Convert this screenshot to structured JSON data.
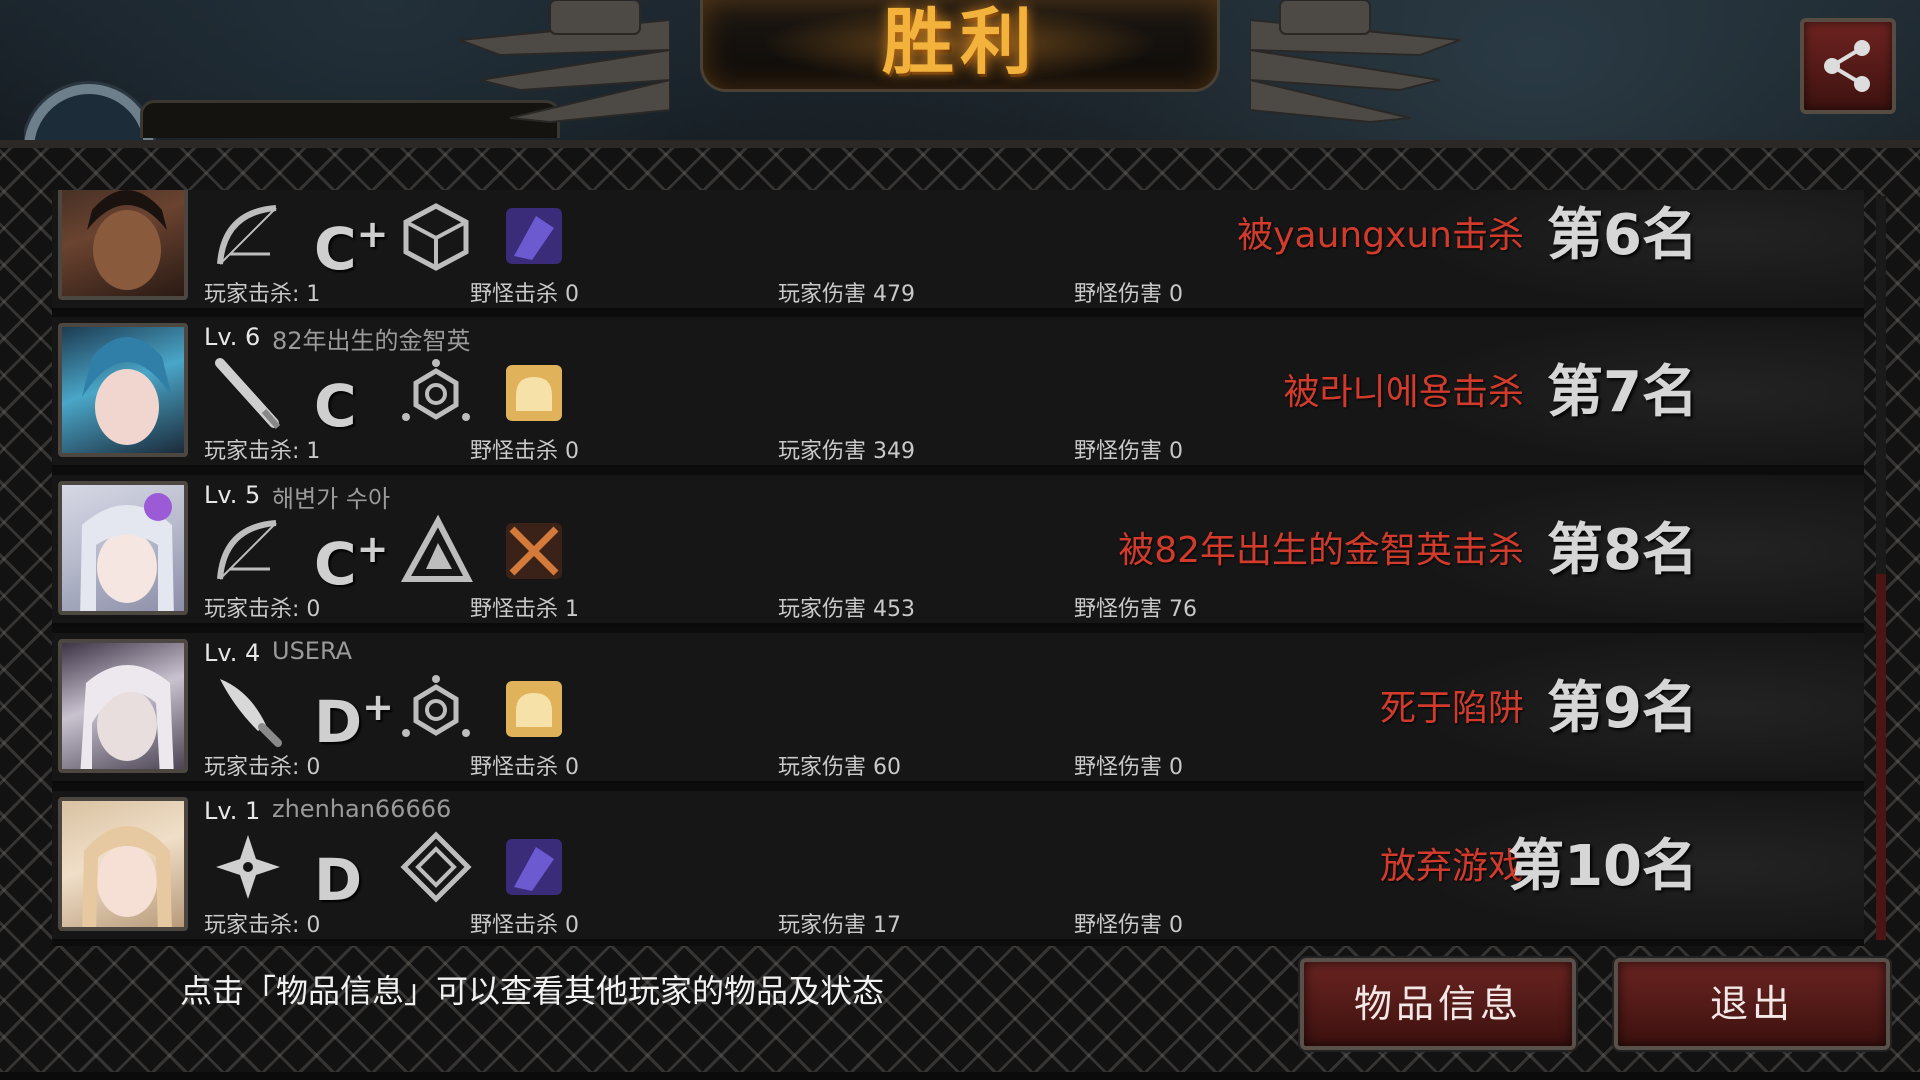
{
  "header": {
    "title": "胜利"
  },
  "footer": {
    "hint": "点击「物品信息」可以查看其他玩家的物品及状态",
    "item_info_button": "物品信息",
    "exit_button": "退出"
  },
  "colors": {
    "accent_gold": "#f2b23c",
    "death_red": "#d23b2c",
    "button_red": "#6a2421"
  },
  "rows": [
    {
      "level": "",
      "name": "",
      "weapon_icon": "bow-icon",
      "grade": "C",
      "grade_plus": "+",
      "skill_icon": "cube-shield-icon",
      "item_icon": "purple-gear-icon",
      "player_kills": "玩家击杀: 1",
      "monster_kills": "野怪击杀 0",
      "player_damage": "玩家伤害 479",
      "monster_damage": "野怪伤害 0",
      "death": "被yaungxun击杀",
      "rank": "第6名"
    },
    {
      "level": "Lv. 6",
      "name": "82年出生的金智英",
      "weapon_icon": "bat-icon",
      "grade": "C",
      "grade_plus": "",
      "skill_icon": "hex-node-icon",
      "item_icon": "bread-icon",
      "player_kills": "玩家击杀: 1",
      "monster_kills": "野怪击杀 0",
      "player_damage": "玩家伤害 349",
      "monster_damage": "野怪伤害 0",
      "death": "被라니에용击杀",
      "rank": "第7名"
    },
    {
      "level": "Lv. 5",
      "name": "해변가 수아",
      "weapon_icon": "bow-icon",
      "grade": "C",
      "grade_plus": "+",
      "skill_icon": "triangle-icon",
      "item_icon": "crossed-blades-icon",
      "player_kills": "玩家击杀: 0",
      "monster_kills": "野怪击杀 1",
      "player_damage": "玩家伤害 453",
      "monster_damage": "野怪伤害 76",
      "death": "被82年出生的金智英击杀",
      "rank": "第8名"
    },
    {
      "level": "Lv. 4",
      "name": "USERA",
      "weapon_icon": "knife-icon",
      "grade": "D",
      "grade_plus": "+",
      "skill_icon": "hex-node-icon",
      "item_icon": "bread-icon",
      "player_kills": "玩家击杀: 0",
      "monster_kills": "野怪击杀 0",
      "player_damage": "玩家伤害 60",
      "monster_damage": "野怪伤害 0",
      "death": "死于陷阱",
      "rank": "第9名"
    },
    {
      "level": "Lv. 1",
      "name": "zhenhan66666",
      "weapon_icon": "shuriken-icon",
      "grade": "D",
      "grade_plus": "",
      "skill_icon": "diamond-icon",
      "item_icon": "purple-gear-icon",
      "player_kills": "玩家击杀: 0",
      "monster_kills": "野怪击杀 0",
      "player_damage": "玩家伤害 17",
      "monster_damage": "野怪伤害 0",
      "death": "放弃游戏",
      "rank": "第10名"
    }
  ]
}
